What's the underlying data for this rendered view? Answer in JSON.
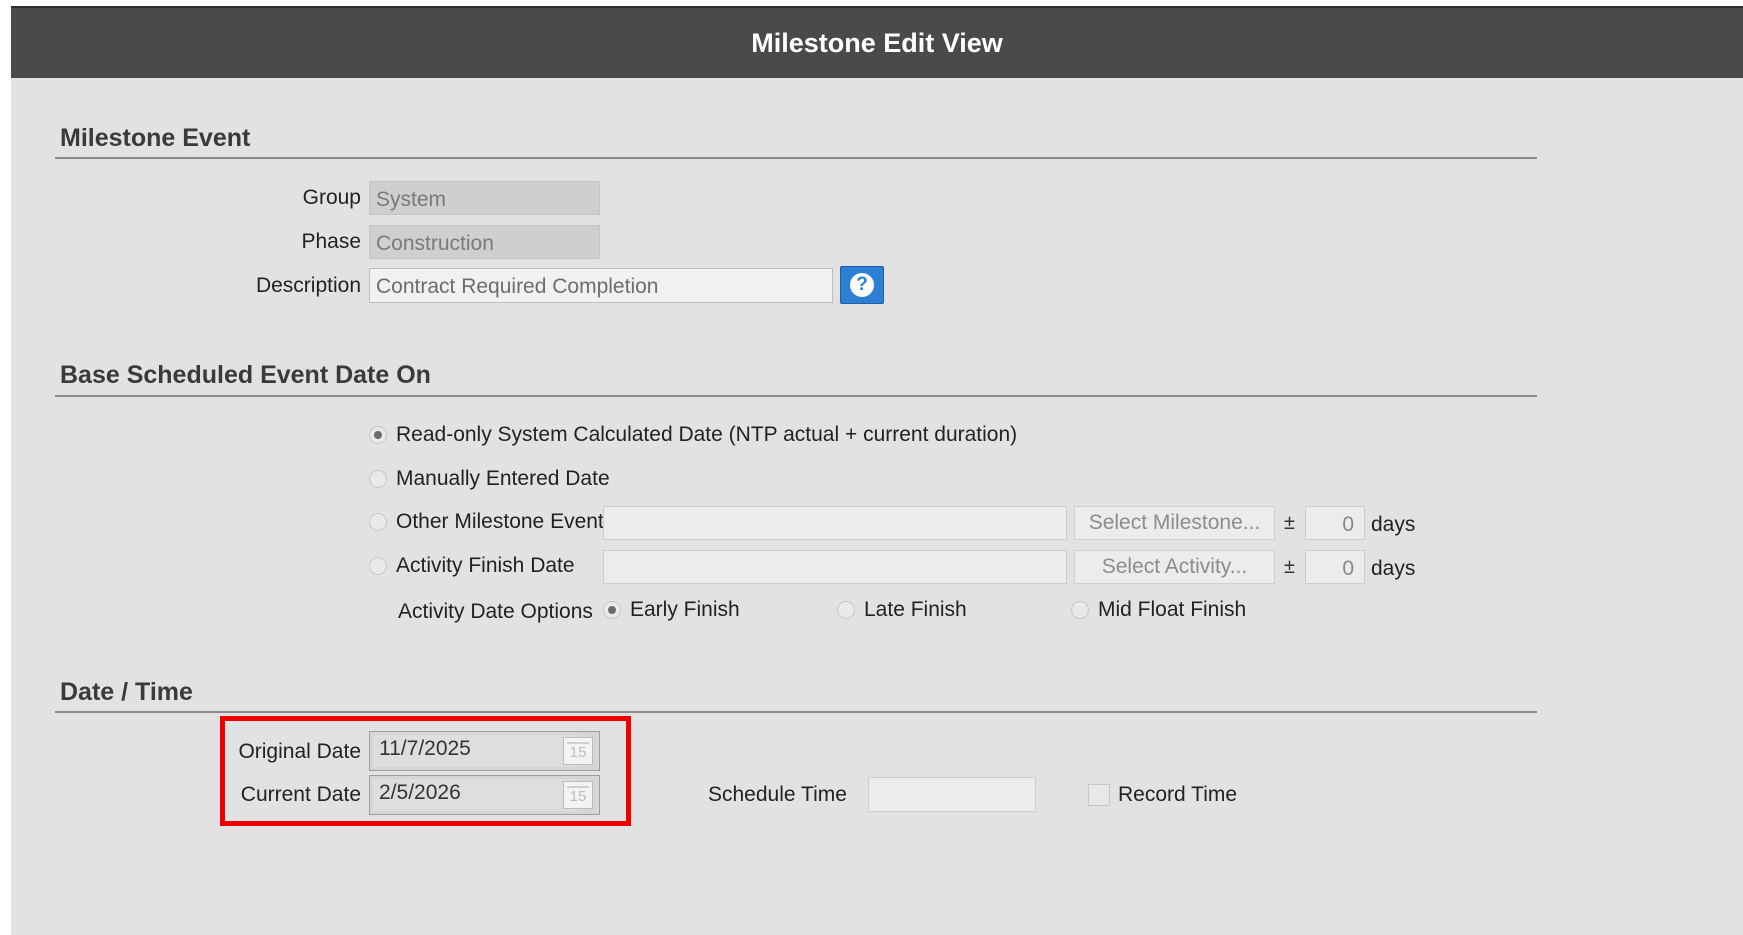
{
  "window": {
    "title": "Milestone Edit View"
  },
  "milestone_event": {
    "heading": "Milestone Event",
    "group_label": "Group",
    "group_value": "System",
    "phase_label": "Phase",
    "phase_value": "Construction",
    "description_label": "Description",
    "description_value": "Contract Required Completion",
    "help_icon": "?"
  },
  "base_scheduled": {
    "heading": "Base Scheduled Event Date On",
    "options": [
      {
        "label": "Read-only System Calculated Date (NTP actual + current duration)",
        "checked": true
      },
      {
        "label": "Manually Entered Date",
        "checked": false
      },
      {
        "label": "Other Milestone Event",
        "checked": false
      },
      {
        "label": "Activity Finish Date",
        "checked": false
      }
    ],
    "select_milestone_label": "Select Milestone...",
    "select_activity_label": "Select Activity...",
    "plus_minus": "±",
    "milestone_offset": "0",
    "activity_offset": "0",
    "days_label": "days",
    "activity_date_options_label": "Activity Date Options",
    "activity_date_options": [
      {
        "label": "Early Finish",
        "checked": true
      },
      {
        "label": "Late Finish",
        "checked": false
      },
      {
        "label": "Mid Float Finish",
        "checked": false
      }
    ]
  },
  "date_time": {
    "heading": "Date / Time",
    "original_date_label": "Original Date",
    "original_date_value": "11/7/2025",
    "current_date_label": "Current Date",
    "current_date_value": "2/5/2026",
    "calendar_icon_text": "15",
    "schedule_time_label": "Schedule Time",
    "schedule_time_value": "",
    "record_time_label": "Record Time",
    "record_time_checked": false
  },
  "colors": {
    "title_bar": "#4a4a4a",
    "panel_background": "#e2e2e2",
    "help_button": "#2d7fd3",
    "highlight_box": "#ee0000"
  }
}
